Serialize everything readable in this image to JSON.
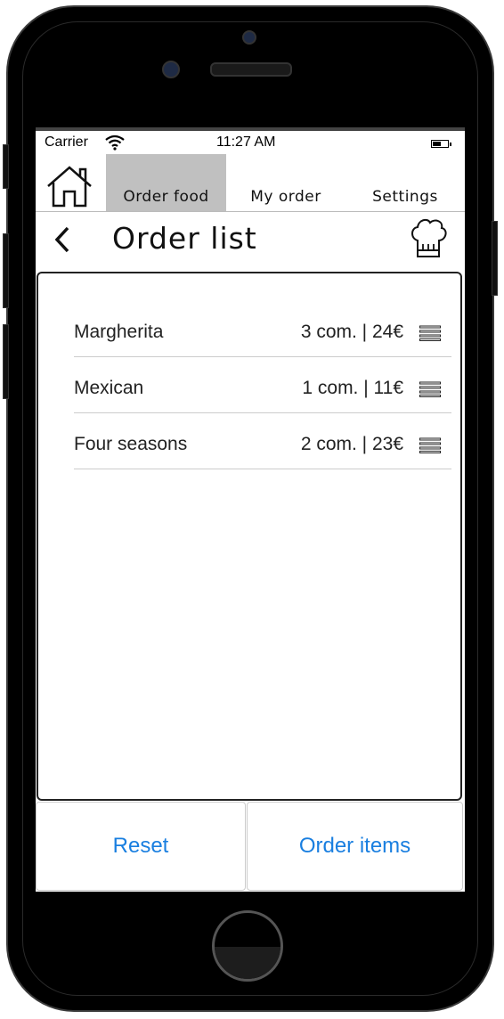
{
  "status_bar": {
    "carrier": "Carrier",
    "time": "11:27 AM"
  },
  "tabs": [
    {
      "label": "Order food",
      "active": true
    },
    {
      "label": "My order",
      "active": false
    },
    {
      "label": "Settings",
      "active": false
    }
  ],
  "header": {
    "title": "Order list"
  },
  "orders": [
    {
      "name": "Margherita",
      "quantity": "3 com. | 24€"
    },
    {
      "name": "Mexican",
      "quantity": "1 com. | 11€"
    },
    {
      "name": "Four seasons",
      "quantity": "2 com. | 23€"
    }
  ],
  "footer": {
    "reset_label": "Reset",
    "order_label": "Order items"
  },
  "colors": {
    "accent": "#1a7fe0",
    "active_tab": "#c0c0c0",
    "device": "#000000"
  },
  "icons": [
    "home-icon",
    "back-icon",
    "chef-hat-icon",
    "drag-handle-icon",
    "wifi-icon",
    "battery-icon"
  ]
}
